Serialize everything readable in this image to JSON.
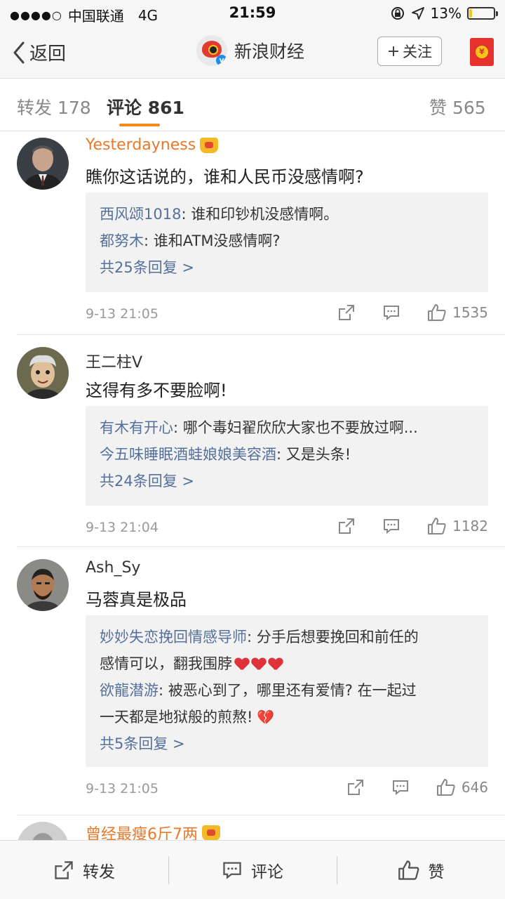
{
  "status_bar": {
    "signal": "●●●●○",
    "carrier": "中国联通",
    "network": "4G",
    "time": "21:59",
    "battery": "13%",
    "battery_level": 0.13
  },
  "nav": {
    "back_label": "返回",
    "title": "新浪财经",
    "follow_label": "关注"
  },
  "tabs": [
    {
      "label": "转发",
      "count": "178"
    },
    {
      "label": "评论",
      "count": "861"
    },
    {
      "label": "赞",
      "count": "565"
    }
  ],
  "comments": [
    {
      "user": "Yesterdayness",
      "text": "瞧你这话说的，谁和人民币没感情啊?",
      "replies": [
        {
          "user": "西风颂1018",
          "text": ": 谁和印钞机没感情啊。"
        },
        {
          "user": "都努木",
          "text": ": 谁和ATM没感情啊?"
        }
      ],
      "more": "共25条回复 >",
      "time": "9-13 21:05",
      "likes": "1535"
    },
    {
      "user": "王二柱V",
      "text": "这得有多不要脸啊!",
      "replies": [
        {
          "user": "有木有开心",
          "text": ": 哪个毒妇翟欣欣大家也不要放过啊..."
        },
        {
          "user": "今五味睡眠酒蛙娘娘美容酒",
          "text": ": 又是头条!"
        }
      ],
      "more": "共24条回复 >",
      "time": "9-13 21:04",
      "likes": "1182"
    },
    {
      "user": "Ash_Sy",
      "text": "马蓉真是极品",
      "replies": [
        {
          "user": "妙妙失恋挽回情感导师",
          "text": ": 分手后想要挽回和前任的",
          "text2": "感情可以，翻我围脖"
        },
        {
          "user": "欲龍潜游",
          "text": ": 被恶心到了，哪里还有爱情? 在一起过",
          "text2": "一天都是地狱般的煎熬!"
        }
      ],
      "more": "共5条回复 >",
      "time": "9-13 21:05",
      "likes": "646"
    },
    {
      "user": "曾经最瘦6斤7两"
    }
  ],
  "bottom_bar": {
    "repost": "转发",
    "comment": "评论",
    "like": "赞"
  }
}
